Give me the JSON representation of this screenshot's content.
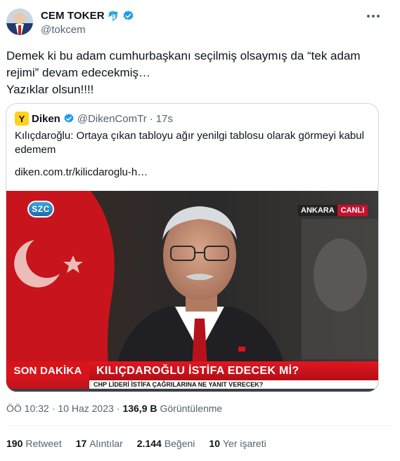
{
  "author": {
    "display_name": "CEM TOKER",
    "handle": "@tokcem",
    "name_emoji": "🐬",
    "verified": true
  },
  "tweet": {
    "lines": [
      "Demek ki bu adam cumhurbaşkanı seçilmiş olsaymış da “tek adam",
      "rejimi” devam edecekmiş…",
      "Yazıklar olsun!!!!"
    ]
  },
  "quoted": {
    "logo_letter": "Y",
    "display_name": "Diken",
    "handle": "@DikenComTr",
    "separator": "·",
    "time": "17s",
    "text": "Kılıçdaroğlu: Ortaya çıkan tabloyu ağır yenilgi tablosu olarak görmeyi kabul edemem",
    "link": "diken.com.tr/kilicdaroglu-h…",
    "media": {
      "channel_logo": "SZC",
      "location": "ANKARA",
      "live": "CANLI",
      "breaking_tag": "SON DAKİKA",
      "headline": "KILIÇDAROĞLU İSTİFA EDECEK Mİ?",
      "subheadline": "CHP LİDERİ İSTİFA ÇAĞRILARINA NE YANIT VERECEK?"
    }
  },
  "meta": {
    "time": "ÖÖ 10:32",
    "dot1": "·",
    "date": "10 Haz 2023",
    "dot2": "·",
    "views_count": "136,9 B",
    "views_label": "Görüntülenme"
  },
  "stats": [
    {
      "count": "190",
      "label": "Retweet"
    },
    {
      "count": "17",
      "label": "Alıntılar"
    },
    {
      "count": "2.144",
      "label": "Beğeni"
    },
    {
      "count": "10",
      "label": "Yer işareti"
    }
  ],
  "colors": {
    "accent": "#1d9bf0",
    "text": "#0f1419",
    "secondary": "#536471",
    "border": "#cfd9de",
    "breaking_red": "#d7141b"
  }
}
